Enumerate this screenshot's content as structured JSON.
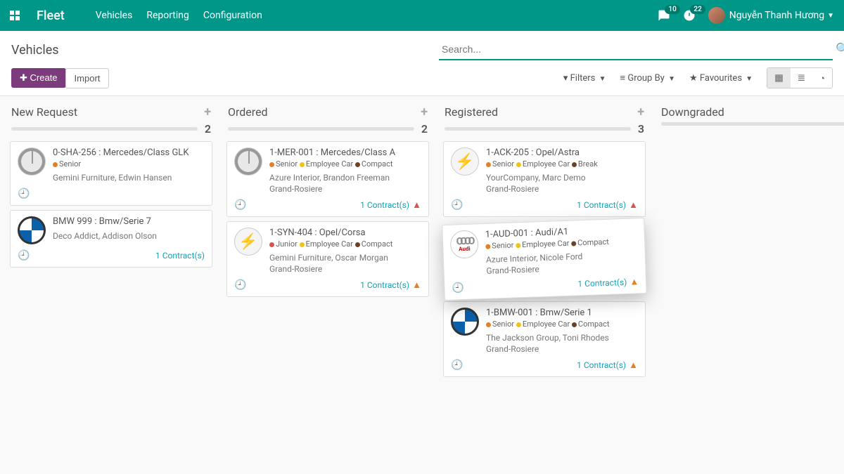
{
  "topbar": {
    "app_title": "Fleet",
    "nav": [
      "Vehicles",
      "Reporting",
      "Configuration"
    ],
    "msg_count": "10",
    "activity_count": "22",
    "user_name": "Nguyễn Thanh Hương"
  },
  "page": {
    "title": "Vehicles",
    "search_placeholder": "Search...",
    "create_label": "Create",
    "import_label": "Import",
    "filters_label": "Filters",
    "groupby_label": "Group By",
    "favourites_label": "Favourites"
  },
  "columns": [
    {
      "title": "New Request",
      "count": "2",
      "cards": [
        {
          "brand": "merc",
          "title": "0-SHA-256 : Mercedes/Class GLK",
          "tags": [
            {
              "color": "orange",
              "label": "Senior"
            }
          ],
          "sub1": "Gemini Furniture, Edwin Hansen",
          "sub2": "",
          "contract": "",
          "warn": ""
        },
        {
          "brand": "bmw",
          "title": "BMW 999 : Bmw/Serie 7",
          "tags": [],
          "sub1": "Deco Addict, Addison Olson",
          "sub2": "",
          "contract": "1 Contract(s)",
          "warn": ""
        }
      ]
    },
    {
      "title": "Ordered",
      "count": "2",
      "cards": [
        {
          "brand": "merc",
          "title": "1-MER-001 : Mercedes/Class A",
          "tags": [
            {
              "color": "orange",
              "label": "Senior"
            },
            {
              "color": "yellow",
              "label": "Employee Car"
            },
            {
              "color": "brown",
              "label": "Compact"
            }
          ],
          "sub1": "Azure Interior, Brandon Freeman",
          "sub2": "Grand-Rosiere",
          "contract": "1 Contract(s)",
          "warn": "red"
        },
        {
          "brand": "opel",
          "title": "1-SYN-404 : Opel/Corsa",
          "tags": [
            {
              "color": "red",
              "label": "Junior"
            },
            {
              "color": "yellow",
              "label": "Employee Car"
            },
            {
              "color": "brown",
              "label": "Compact"
            }
          ],
          "sub1": "Gemini Furniture, Oscar Morgan",
          "sub2": "Grand-Rosiere",
          "contract": "1 Contract(s)",
          "warn": "orange"
        }
      ]
    },
    {
      "title": "Registered",
      "count": "3",
      "cards": [
        {
          "brand": "opel",
          "title": "1-ACK-205 : Opel/Astra",
          "tags": [
            {
              "color": "orange",
              "label": "Senior"
            },
            {
              "color": "yellow",
              "label": "Employee Car"
            },
            {
              "color": "brown",
              "label": "Break"
            }
          ],
          "sub1": "YourCompany, Marc Demo",
          "sub2": "Grand-Rosiere",
          "contract": "1 Contract(s)",
          "warn": "red"
        },
        {
          "brand": "audi",
          "lifted": true,
          "title": "1-AUD-001 : Audi/A1",
          "tags": [
            {
              "color": "orange",
              "label": "Senior"
            },
            {
              "color": "yellow",
              "label": "Employee Car"
            },
            {
              "color": "brown",
              "label": "Compact"
            }
          ],
          "sub1": "Azure Interior, Nicole Ford",
          "sub2": "Grand-Rosiere",
          "contract": "1 Contract(s)",
          "warn": "orange"
        },
        {
          "brand": "bmw",
          "title": "1-BMW-001 : Bmw/Serie 1",
          "tags": [
            {
              "color": "orange",
              "label": "Senior"
            },
            {
              "color": "yellow",
              "label": "Employee Car"
            },
            {
              "color": "brown",
              "label": "Compact"
            }
          ],
          "sub1": "The Jackson Group, Toni Rhodes",
          "sub2": "Grand-Rosiere",
          "contract": "1 Contract(s)",
          "warn": "orange"
        }
      ]
    },
    {
      "title": "Downgraded",
      "count": "",
      "cards": []
    }
  ]
}
